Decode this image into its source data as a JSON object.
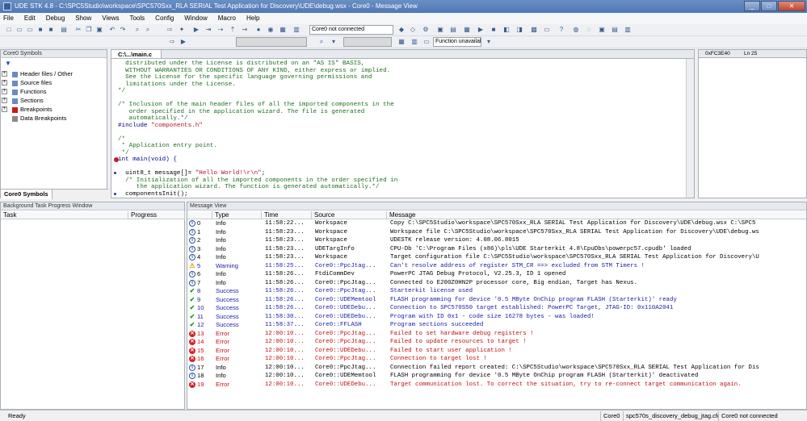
{
  "window": {
    "title": "UDE STK 4.8 - C:\\SPC5Studio\\workspace\\SPC570Sxx_RLA SERIAL Test Application for Discovery\\UDE\\debug.wsx - Core0 - Message View",
    "minimize": "_",
    "maximize": "□",
    "close": "✕"
  },
  "menu": [
    "File",
    "Edit",
    "Debug",
    "Show",
    "Views",
    "Tools",
    "Config",
    "Window",
    "Macro",
    "Help"
  ],
  "toolbar": {
    "core_status": "Core0 not connected",
    "function_status": "Function unavailabl",
    "address": "0xFC3E40",
    "line": "Ln 25"
  },
  "symbols_panel": {
    "title": "Core0 Symbols",
    "tab": "Core0 Symbols",
    "items": [
      "Header files / Other",
      "Source files",
      "Functions",
      "Sections",
      "Breakpoints",
      "Data Breakpoints"
    ]
  },
  "editor": {
    "tab": "C:\\...\\main.c",
    "lines": [
      {
        "text": "  distributed under the License is distributed on an \"AS IS\" BASIS,",
        "cls": "cmt"
      },
      {
        "text": "  WITHOUT WARRANTIES OR CONDITIONS OF ANY KIND, either express or implied.",
        "cls": "cmt"
      },
      {
        "text": "  See the License for the specific language governing permissions and",
        "cls": "cmt"
      },
      {
        "text": "  limitations under the License.",
        "cls": "cmt"
      },
      {
        "text": "*/",
        "cls": "cmt"
      },
      {
        "text": "",
        "cls": ""
      },
      {
        "text": "/* Inclusion of the main header files of all the imported components in the",
        "cls": "cmt"
      },
      {
        "text": "   order specified in the application wizard. The file is generated",
        "cls": "cmt"
      },
      {
        "text": "   automatically.*/",
        "cls": "cmt"
      },
      {
        "text": "#include \"components.h\"",
        "cls": "inc"
      },
      {
        "text": "",
        "cls": ""
      },
      {
        "text": "/*",
        "cls": "cmt"
      },
      {
        "text": " * Application entry point.",
        "cls": "cmt"
      },
      {
        "text": " */",
        "cls": "cmt"
      },
      {
        "text": "int main(void) {",
        "cls": "kw",
        "marker": "bp"
      },
      {
        "text": "",
        "cls": ""
      },
      {
        "text": "  uint8_t message[]= \"Hello World!\\r\\n\";",
        "cls": "msg",
        "marker": "dot"
      },
      {
        "text": "  /* Initialization of all the imported components in the order specified in",
        "cls": "cmt"
      },
      {
        "text": "     the application wizard. The function is generated automatically.*/",
        "cls": "cmt"
      },
      {
        "text": "  componentsInit();",
        "cls": "",
        "marker": "dot"
      }
    ]
  },
  "task_panel": {
    "title": "Background Task Progress Window",
    "columns": [
      "Task",
      "Progress"
    ]
  },
  "message_view": {
    "title": "Message View",
    "columns": [
      "",
      "Type",
      "Time",
      "Source",
      "Message"
    ],
    "rows": [
      {
        "id": "0",
        "kind": "info",
        "type": "Info",
        "time": "11:58:22...",
        "source": "Workspace",
        "message": "Copy C:\\SPC5Studio\\workspace\\SPC570Sxx_RLA SERIAL Test Application for Discovery\\UDE\\debug.wsx C:\\SPC5"
      },
      {
        "id": "1",
        "kind": "info",
        "type": "Info",
        "time": "11:58:23...",
        "source": "Workspace",
        "message": "Workspace file C:\\SPC5Studio\\workspace\\SPC570Sxx_RLA SERIAL Test Application for Discovery\\UDE\\debug.ws"
      },
      {
        "id": "2",
        "kind": "info",
        "type": "Info",
        "time": "11:58:23...",
        "source": "Workspace",
        "message": "UDESTK release version: 4.08.06.8015"
      },
      {
        "id": "3",
        "kind": "info",
        "type": "Info",
        "time": "11:58:23...",
        "source": "UDETargInfo",
        "message": "CPU-Db 'C:\\Program Files (x86)\\pls\\UDE Starterkit 4.8\\CpuDbs\\powerpc57.cpudb' loaded"
      },
      {
        "id": "4",
        "kind": "info",
        "type": "Info",
        "time": "11:58:23...",
        "source": "Workspace",
        "message": "Target configuration file C:\\SPC5Studio\\workspace\\SPC570Sxx_RLA SERIAL Test Application for Discovery\\U"
      },
      {
        "id": "5",
        "kind": "warn",
        "type": "Warning",
        "time": "11:58:25...",
        "source": "Core0::PpcJtag...",
        "message": "Can't resolve address of register STM_CR ==> excluded from STM Timers !"
      },
      {
        "id": "6",
        "kind": "info",
        "type": "Info",
        "time": "11:58:26...",
        "source": "FtdiCommDev",
        "message": "PowerPC JTAG Debug Protocol, V2.25.3, ID 1 opened"
      },
      {
        "id": "7",
        "kind": "info",
        "type": "Info",
        "time": "11:58:26...",
        "source": "Core0::PpcJtag...",
        "message": "Connected to E200Z0HN2P processor core, Big endian, Target has Nexus."
      },
      {
        "id": "8",
        "kind": "succ",
        "type": "Success",
        "time": "11:58:26...",
        "source": "Core0::PpcJtag...",
        "message": "Starterkit license used"
      },
      {
        "id": "9",
        "kind": "succ",
        "type": "Success",
        "time": "11:58:26...",
        "source": "Core0::UDEMemtool",
        "message": "FLASH programming for device '0.5 MByte OnChip program FLASH (Starterkit)' ready"
      },
      {
        "id": "10",
        "kind": "succ",
        "type": "Success",
        "time": "11:58:26...",
        "source": "Core0::UDEDebu...",
        "message": "Connection to SPC570S50 target established: PowerPC Target, JTAG-ID: 0x110A2041"
      },
      {
        "id": "11",
        "kind": "succ",
        "type": "Success",
        "time": "11:58:30...",
        "source": "Core0::UDEDebu...",
        "message": "Program with ID 0x1 - code size 16278 bytes - was loaded!"
      },
      {
        "id": "12",
        "kind": "succ",
        "type": "Success",
        "time": "11:58:37...",
        "source": "Core0::FFLASH",
        "message": "Program sections succeeded"
      },
      {
        "id": "13",
        "kind": "err",
        "type": "Error",
        "time": "12:00:10...",
        "source": "Core0::PpcJtag...",
        "message": "Failed to set hardware debug registers !"
      },
      {
        "id": "14",
        "kind": "err",
        "type": "Error",
        "time": "12:00:10...",
        "source": "Core0::PpcJtag...",
        "message": "Failed to update resources to target !"
      },
      {
        "id": "15",
        "kind": "err",
        "type": "Error",
        "time": "12:00:10...",
        "source": "Core0::UDEDebu...",
        "message": "Failed to start user application !"
      },
      {
        "id": "16",
        "kind": "err",
        "type": "Error",
        "time": "12:00:10...",
        "source": "Core0::PpcJtag...",
        "message": "Connection to target lost !"
      },
      {
        "id": "17",
        "kind": "info",
        "type": "Info",
        "time": "12:00:10...",
        "source": "Core0::PpcJtag...",
        "message": "Connection failed report created: C:\\SPC5Studio\\workspace\\SPC570Sxx_RLA SERIAL Test Application for Dis"
      },
      {
        "id": "18",
        "kind": "info",
        "type": "Info",
        "time": "12:00:10...",
        "source": "Core0::UDEMemtool",
        "message": "FLASH programming for device '0.5 MByte OnChip program FLASH (Starterkit)' deactivated"
      },
      {
        "id": "19",
        "kind": "err",
        "type": "Error",
        "time": "12:00:10...",
        "source": "Core0::UDEDebu...",
        "message": "Target communication lost. To correct the situation, try to re-connect target communication again."
      }
    ]
  },
  "statusbar": {
    "left": "Ready",
    "core": "Core0",
    "config": "spc570s_discovery_debug_jtag.cfg",
    "connection": "Core0 not connected"
  }
}
